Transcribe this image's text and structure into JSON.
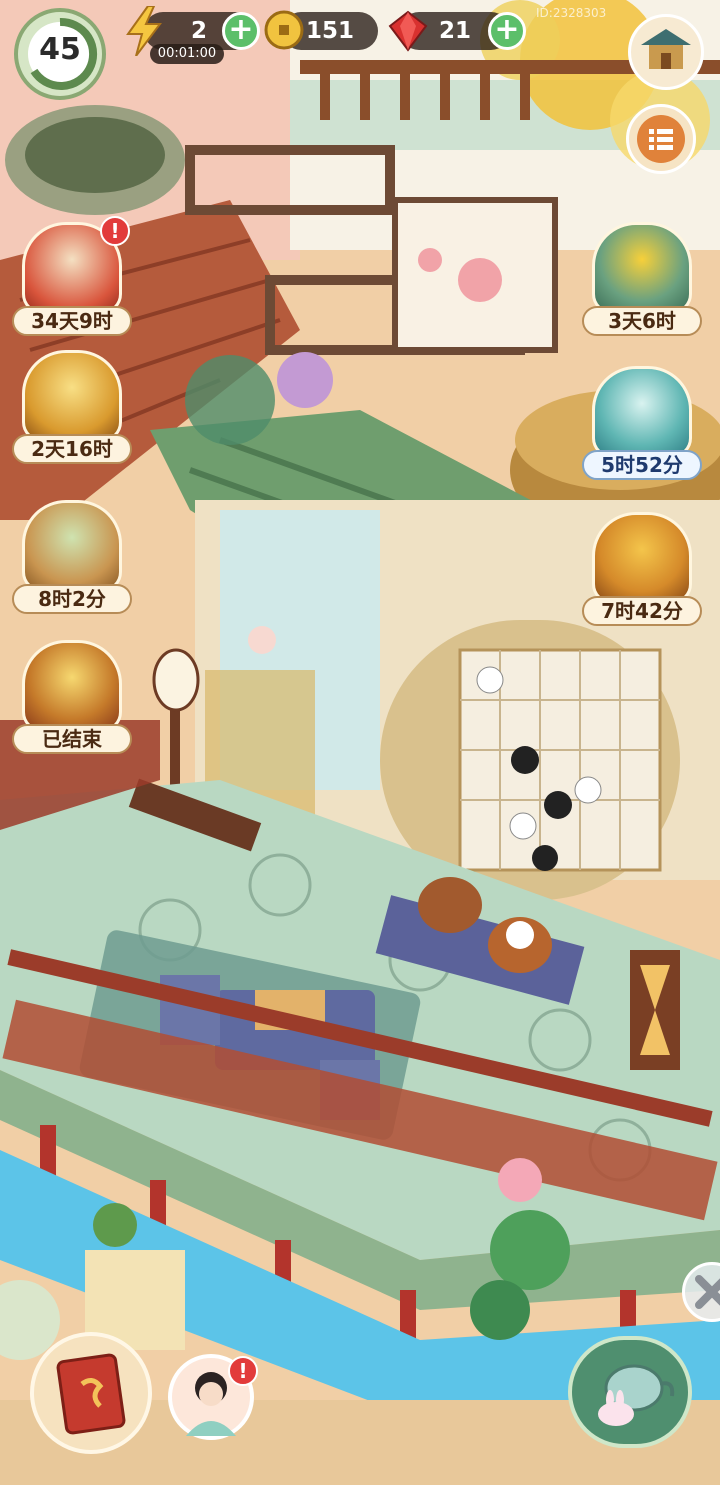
{
  "hud": {
    "level": "45",
    "energy": "2",
    "energy_timer": "00:01:00",
    "coins": "151",
    "gems": "21",
    "player_id": "ID:2328303"
  },
  "left_events": [
    {
      "icon": "book-event-icon",
      "label": "34天9时",
      "alert": "!"
    },
    {
      "icon": "treasure-chest-icon",
      "label": "2天16时"
    },
    {
      "icon": "deer-spirit-icon",
      "label": "8时2分"
    },
    {
      "icon": "wheat-harvest-icon",
      "label": "已结束"
    }
  ],
  "right_events": [
    {
      "icon": "chrysanthemum-icon",
      "label": "3天6时"
    },
    {
      "icon": "cat-gift-box-icon",
      "label": "5时52分"
    },
    {
      "icon": "plus-one-scroll-icon",
      "label": "7时42分"
    }
  ],
  "bottom": {
    "journal_icon": "journal-book-icon",
    "character_alert": "!",
    "teapot_icon": "teapot-bunny-icon"
  },
  "colors": {
    "roof_green": "#6f9e6e",
    "railing_red": "#9b3c2a",
    "water_blue": "#5cc4e8",
    "floor_mint": "#b9d8c2",
    "add_button_green": "#5cbf6a"
  }
}
